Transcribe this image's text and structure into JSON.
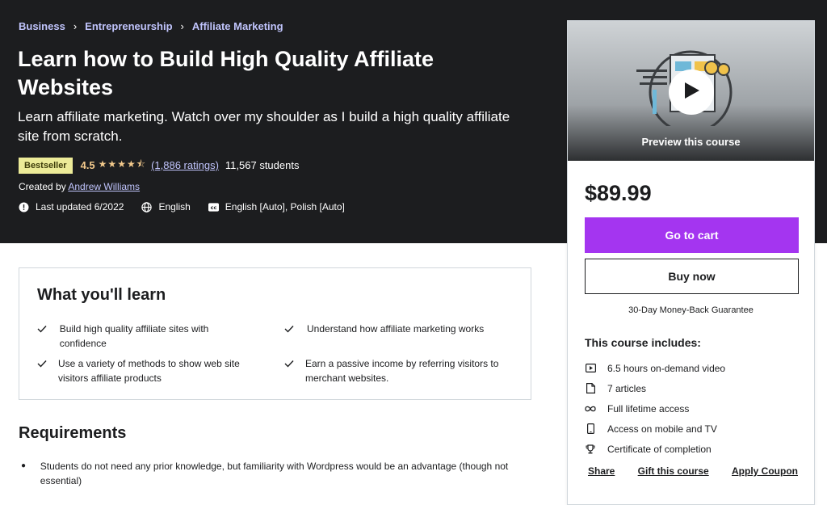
{
  "breadcrumb": [
    "Business",
    "Entrepreneurship",
    "Affiliate Marketing"
  ],
  "course": {
    "title": "Learn how to Build High Quality Affiliate Websites",
    "subtitle": "Learn affiliate marketing. Watch over my shoulder as I build a high quality affiliate site from scratch.",
    "badge": "Bestseller",
    "rating": "4.5",
    "stars": "★★★★⯪",
    "ratings_count": "(1,886 ratings)",
    "students": "11,567 students",
    "created_by_label": "Created by",
    "author": "Andrew Williams",
    "last_updated": "Last updated 6/2022",
    "language": "English",
    "captions": "English [Auto], Polish [Auto]"
  },
  "sidebar": {
    "preview_label": "Preview this course",
    "price": "$89.99",
    "cart_button": "Go to cart",
    "buy_button": "Buy now",
    "guarantee": "30-Day Money-Back Guarantee",
    "includes_title": "This course includes:",
    "includes": [
      {
        "icon": "video-icon",
        "text": "6.5 hours on-demand video"
      },
      {
        "icon": "file-icon",
        "text": "7 articles"
      },
      {
        "icon": "infinity-icon",
        "text": "Full lifetime access"
      },
      {
        "icon": "mobile-icon",
        "text": "Access on mobile and TV"
      },
      {
        "icon": "trophy-icon",
        "text": "Certificate of completion"
      }
    ],
    "links": [
      "Share",
      "Gift this course",
      "Apply Coupon"
    ]
  },
  "learn": {
    "title": "What you'll learn",
    "items": [
      "Build high quality affiliate sites with confidence",
      "Understand how affiliate marketing works",
      "Use a variety of methods to show web site visitors affiliate products",
      "Earn a passive income by referring visitors to merchant websites."
    ]
  },
  "requirements": {
    "title": "Requirements",
    "items": [
      "Students do not need any prior knowledge, but familiarity with Wordpress would be an advantage (though not essential)"
    ]
  },
  "colors": {
    "hero_bg": "#1c1d1f",
    "link_purple": "#c0c4fc",
    "accent": "#a435f0",
    "star": "#f3ca8c",
    "badge_bg": "#eceb98"
  }
}
